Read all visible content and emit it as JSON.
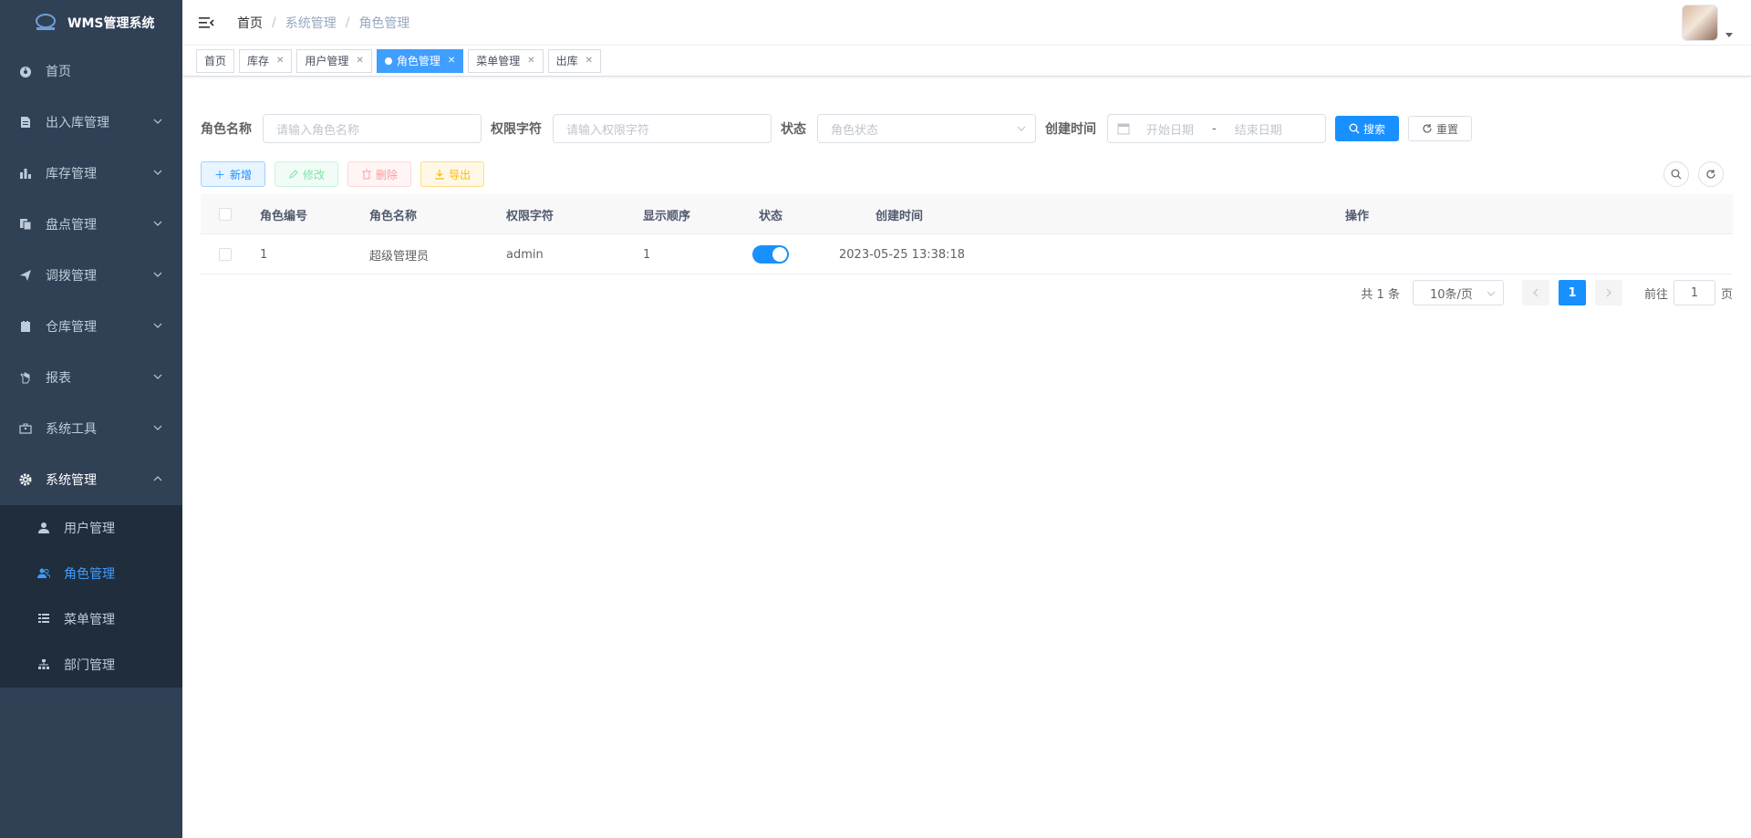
{
  "app": {
    "title": "WMS管理系统"
  },
  "sidebar": {
    "items": [
      {
        "label": "首页",
        "icon": "dashboard-icon",
        "has_arrow": false
      },
      {
        "label": "出入库管理",
        "icon": "document-icon",
        "has_arrow": true
      },
      {
        "label": "库存管理",
        "icon": "bar-chart-icon",
        "has_arrow": true
      },
      {
        "label": "盘点管理",
        "icon": "copy-icon",
        "has_arrow": true
      },
      {
        "label": "调拨管理",
        "icon": "send-icon",
        "has_arrow": true
      },
      {
        "label": "仓库管理",
        "icon": "clipboard-icon",
        "has_arrow": true
      },
      {
        "label": "报表",
        "icon": "hand-icon",
        "has_arrow": true
      },
      {
        "label": "系统工具",
        "icon": "toolbox-icon",
        "has_arrow": true
      },
      {
        "label": "系统管理",
        "icon": "gear-icon",
        "has_arrow": true,
        "expanded": true
      }
    ],
    "subitems": [
      {
        "label": "用户管理",
        "icon": "user-icon",
        "active": false
      },
      {
        "label": "角色管理",
        "icon": "peoples-icon",
        "active": true
      },
      {
        "label": "菜单管理",
        "icon": "tree-table-icon",
        "active": false
      },
      {
        "label": "部门管理",
        "icon": "tree-icon",
        "active": false
      }
    ]
  },
  "breadcrumb": [
    "首页",
    "系统管理",
    "角色管理"
  ],
  "tags": [
    {
      "label": "首页",
      "closable": false,
      "active": false
    },
    {
      "label": "库存",
      "closable": true,
      "active": false
    },
    {
      "label": "用户管理",
      "closable": true,
      "active": false
    },
    {
      "label": "角色管理",
      "closable": true,
      "active": true
    },
    {
      "label": "菜单管理",
      "closable": true,
      "active": false
    },
    {
      "label": "出库",
      "closable": true,
      "active": false
    }
  ],
  "search": {
    "role_name_label": "角色名称",
    "role_name_placeholder": "请输入角色名称",
    "perm_label": "权限字符",
    "perm_placeholder": "请输入权限字符",
    "status_label": "状态",
    "status_placeholder": "角色状态",
    "created_label": "创建时间",
    "start_placeholder": "开始日期",
    "range_sep": "-",
    "end_placeholder": "结束日期",
    "search_btn": "搜索",
    "reset_btn": "重置"
  },
  "toolbar": {
    "add": "新增",
    "edit": "修改",
    "delete": "删除",
    "export": "导出"
  },
  "table": {
    "headers": [
      "角色编号",
      "角色名称",
      "权限字符",
      "显示顺序",
      "状态",
      "创建时间",
      "操作"
    ],
    "rows": [
      {
        "id": "1",
        "name": "超级管理员",
        "key": "admin",
        "sort": "1",
        "status_on": true,
        "created": "2023-05-25 13:38:18"
      }
    ]
  },
  "pagination": {
    "total": "共 1 条",
    "page_size": "10条/页",
    "current": "1",
    "goto_label": "前往",
    "goto_value": "1",
    "goto_suffix": "页"
  },
  "colors": {
    "sidebar_bg": "#304156",
    "submenu_bg": "#1f2d3d",
    "primary": "#1890ff",
    "active_menu_text": "#409eff"
  }
}
